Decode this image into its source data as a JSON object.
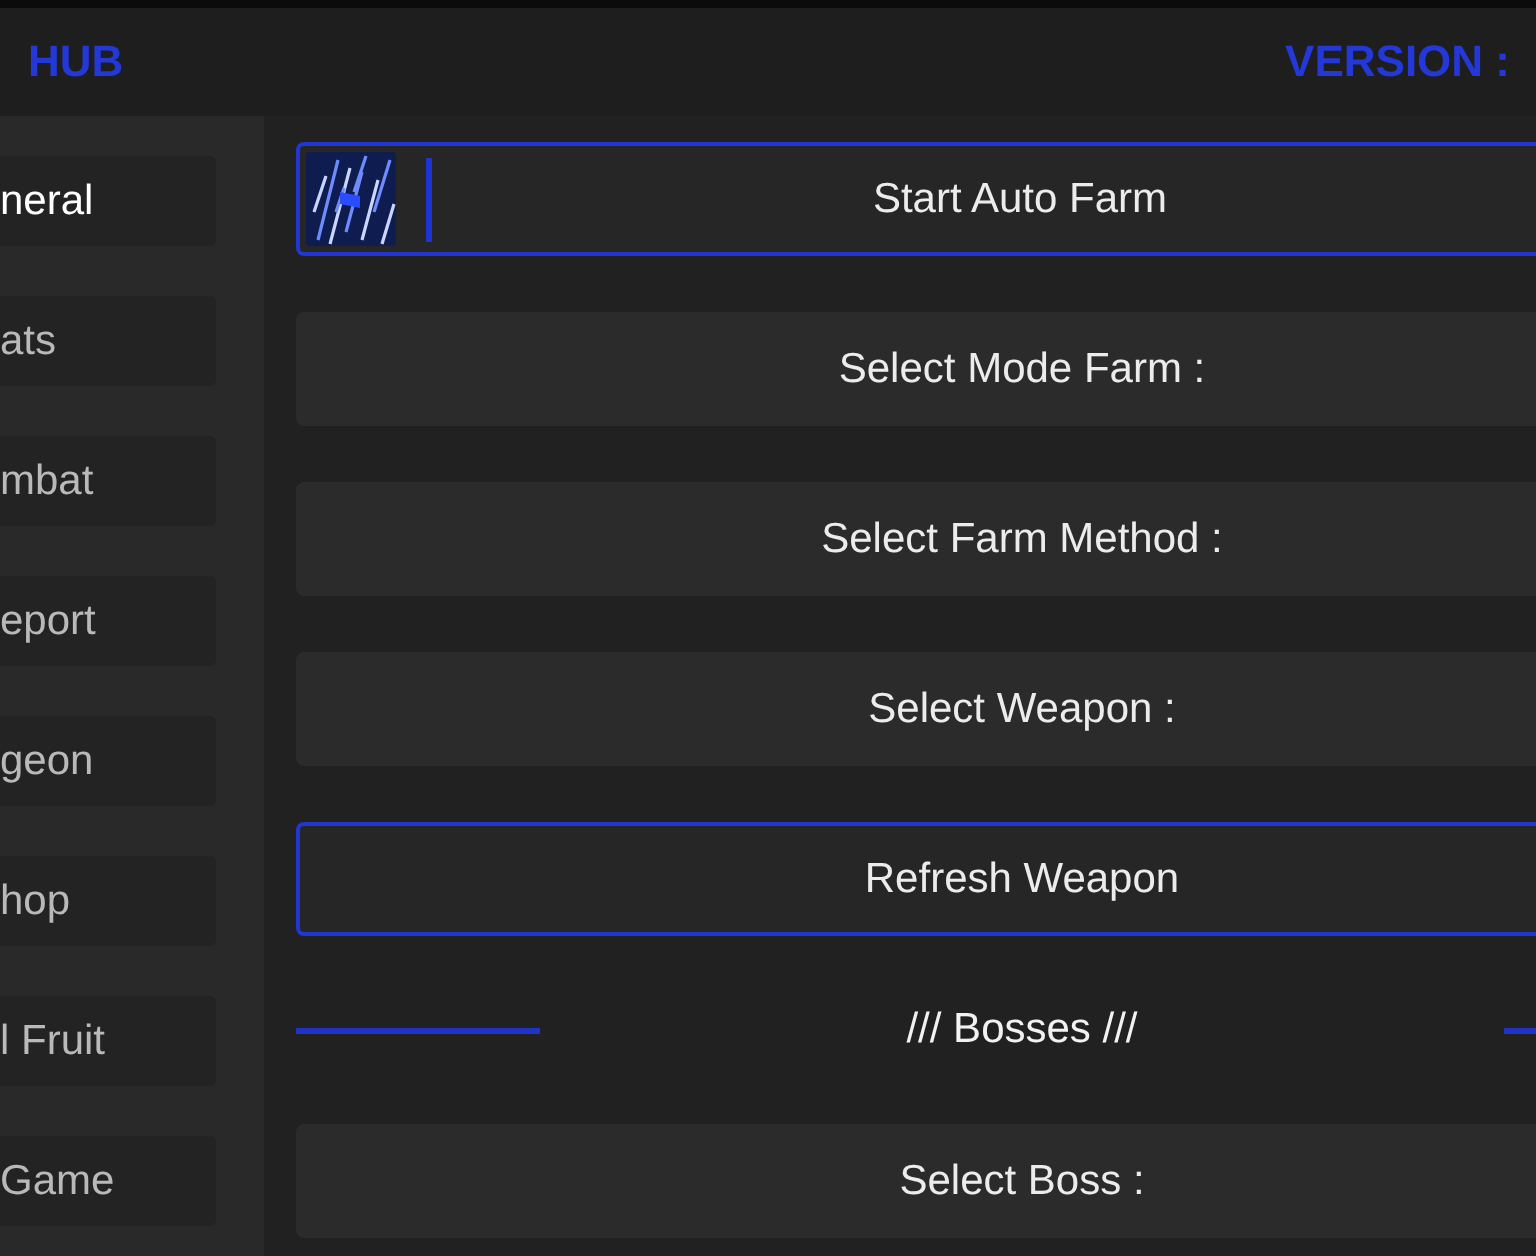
{
  "header": {
    "title": "HUB",
    "version": "VERSION :"
  },
  "sidebar": {
    "items": [
      {
        "label": "neral",
        "selected": true
      },
      {
        "label": "ats",
        "selected": false
      },
      {
        "label": "mbat",
        "selected": false
      },
      {
        "label": "eport",
        "selected": false
      },
      {
        "label": "geon",
        "selected": false
      },
      {
        "label": "hop",
        "selected": false
      },
      {
        "label": "l Fruit",
        "selected": false
      },
      {
        "label": "Game",
        "selected": false
      }
    ]
  },
  "main": {
    "items": [
      {
        "kind": "toggle",
        "label": "Start Auto Farm"
      },
      {
        "kind": "dropdown",
        "label": "Select Mode Farm :"
      },
      {
        "kind": "dropdown",
        "label": "Select Farm Method :"
      },
      {
        "kind": "dropdown",
        "label": "Select Weapon :"
      },
      {
        "kind": "button",
        "label": "Refresh Weapon"
      },
      {
        "kind": "section",
        "label": "/// Bosses ///"
      },
      {
        "kind": "dropdown",
        "label": "Select Boss :"
      }
    ]
  }
}
